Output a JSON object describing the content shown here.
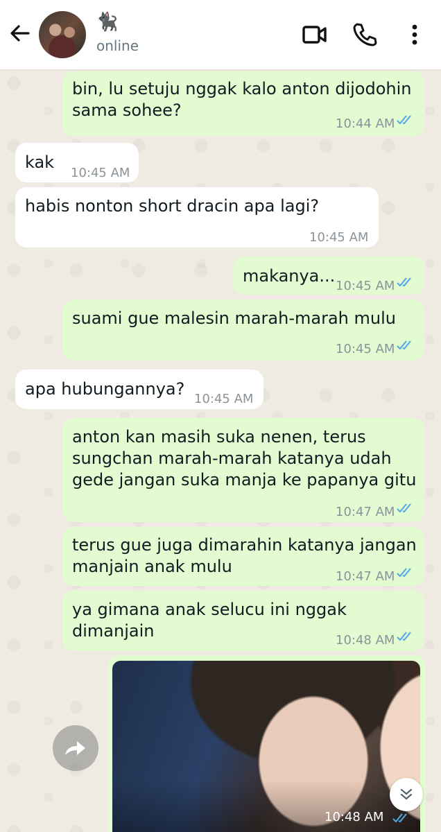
{
  "header": {
    "contact_name": "🐈‍⬛",
    "status": "online",
    "icons": [
      "back-arrow-icon",
      "video-call-icon",
      "phone-icon",
      "more-options-icon"
    ]
  },
  "messages": [
    {
      "id": "m1",
      "direction": "out",
      "text": "bin, lu setuju nggak kalo anton dijodohin\nsama sohee?",
      "time": "10:44 AM",
      "read": true
    },
    {
      "id": "m2",
      "direction": "in",
      "text": "kak",
      "time": "10:45 AM"
    },
    {
      "id": "m3",
      "direction": "in",
      "text": "habis nonton short dracin apa lagi?",
      "time": "10:45 AM"
    },
    {
      "id": "m4",
      "direction": "out",
      "text": "makanya...",
      "time": "10:45 AM",
      "read": true
    },
    {
      "id": "m5",
      "direction": "out",
      "text": "suami gue malesin marah-marah mulu",
      "time": "10:45 AM",
      "read": true
    },
    {
      "id": "m6",
      "direction": "in",
      "text": "apa hubungannya?",
      "time": "10:45 AM"
    },
    {
      "id": "m7",
      "direction": "out",
      "text": "anton kan masih suka nenen, terus\nsungchan marah-marah katanya udah\ngede jangan suka manja ke papanya gitu",
      "time": "10:47 AM",
      "read": true
    },
    {
      "id": "m8",
      "direction": "out",
      "text": "terus gue juga dimarahin katanya jangan\nmanjain anak mulu",
      "time": "10:47 AM",
      "read": true
    },
    {
      "id": "m9",
      "direction": "out",
      "text": "ya gimana anak selucu ini nggak\ndimanjain",
      "time": "10:48 AM",
      "read": true
    }
  ],
  "photo_message": {
    "direction": "out",
    "time": "10:48 AM",
    "read": true
  },
  "colors": {
    "outgoing_bubble": "#e2fbd0",
    "incoming_bubble": "#ffffff",
    "read_ticks": "#4fa6e8",
    "background": "#efeae2"
  }
}
